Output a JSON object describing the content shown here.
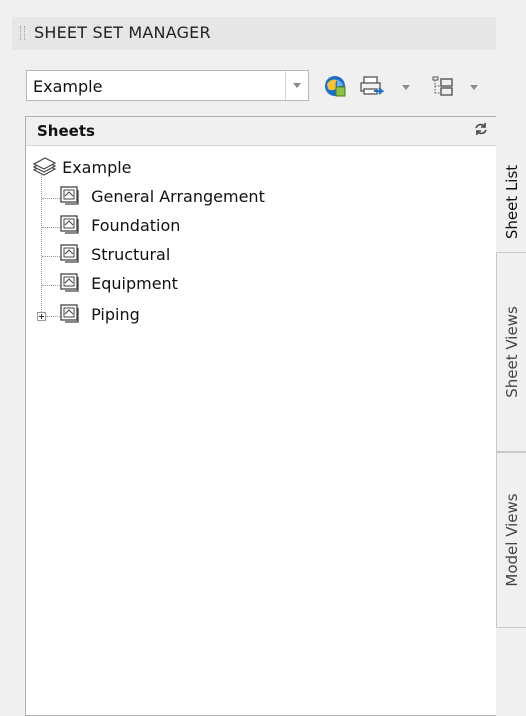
{
  "panel": {
    "title": "SHEET SET MANAGER"
  },
  "toolbar": {
    "sheetset_selector_value": "Example",
    "icons": [
      "sheet-set-icon",
      "publish-icon",
      "view-options-icon"
    ]
  },
  "tree": {
    "header": "Sheets",
    "root": {
      "label": "Example"
    },
    "items": [
      {
        "label": "General Arrangement"
      },
      {
        "label": "Foundation"
      },
      {
        "label": "Structural"
      },
      {
        "label": "Equipment"
      },
      {
        "label": "Piping"
      }
    ]
  },
  "tabs": [
    {
      "label": "Sheet List",
      "active": true
    },
    {
      "label": "Sheet Views",
      "active": false
    },
    {
      "label": "Model Views",
      "active": false
    }
  ]
}
